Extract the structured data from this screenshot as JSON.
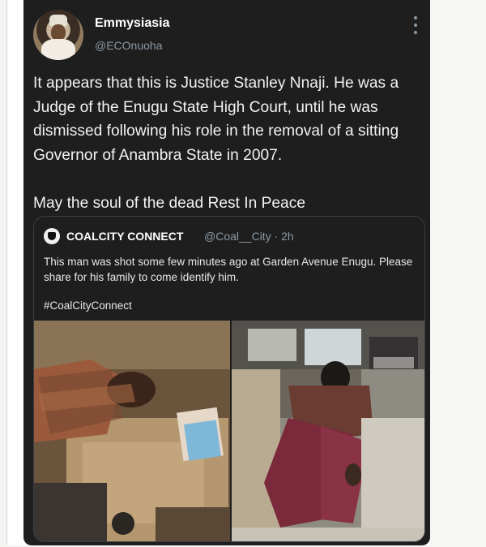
{
  "tweet": {
    "display_name": "Emmysiasia",
    "handle": "@ECOnuoha",
    "text": "It appears that this is Justice Stanley Nnaji. He was a Judge of the Enugu State High Court, until he was dismissed following his role in the removal of a sitting Governor of Anambra State in 2007.\n\nMay the soul of the dead Rest In Peace"
  },
  "quoted_tweet": {
    "display_name": "COALCITY CONNECT",
    "handle_time": "@Coal__City · 2h",
    "text": "This man was shot some few minutes ago at Garden Avenue Enugu. Please share for his family to come identify him.",
    "hashtag": "#CoalCityConnect"
  },
  "colors": {
    "tweet_background": "#1e1e1e",
    "text_primary": "#f2f2f2",
    "text_secondary": "#8b98a5",
    "card_border": "#3a3f45"
  },
  "icons": {
    "more": "vertical-ellipsis-icon"
  }
}
